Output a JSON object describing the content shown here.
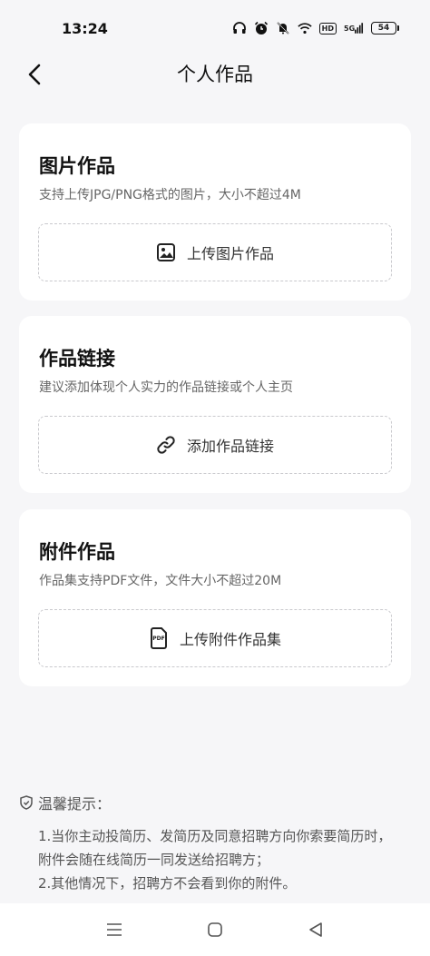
{
  "status_bar": {
    "time": "13:24",
    "icons": [
      "headphones-icon",
      "alarm-icon",
      "mute-icon",
      "wifi-icon",
      "hd-icon",
      "signal-5g-icon"
    ],
    "hd_text": "HD",
    "network_text": "5G",
    "battery_level": "54"
  },
  "header": {
    "title": "个人作品"
  },
  "cards": [
    {
      "title": "图片作品",
      "desc": "支持上传JPG/PNG格式的图片，大小不超过4M",
      "action_label": "上传图片作品",
      "icon": "image-icon"
    },
    {
      "title": "作品链接",
      "desc": "建议添加体现个人实力的作品链接或个人主页",
      "action_label": "添加作品链接",
      "icon": "link-icon"
    },
    {
      "title": "附件作品",
      "desc": "作品集支持PDF文件，文件大小不超过20M",
      "action_label": "上传附件作品集",
      "icon": "pdf-icon",
      "icon_text": "PDF"
    }
  ],
  "tips": {
    "title": "温馨提示：",
    "lines": [
      "1.当你主动投简历、发简历及同意招聘方向你索要简历时，",
      "附件会随在线简历一同发送给招聘方；",
      "2.其他情况下，招聘方不会看到你的附件。"
    ]
  },
  "colors": {
    "background": "#f6f6f8",
    "card": "#ffffff",
    "dashed_border": "#c9c9cd"
  }
}
